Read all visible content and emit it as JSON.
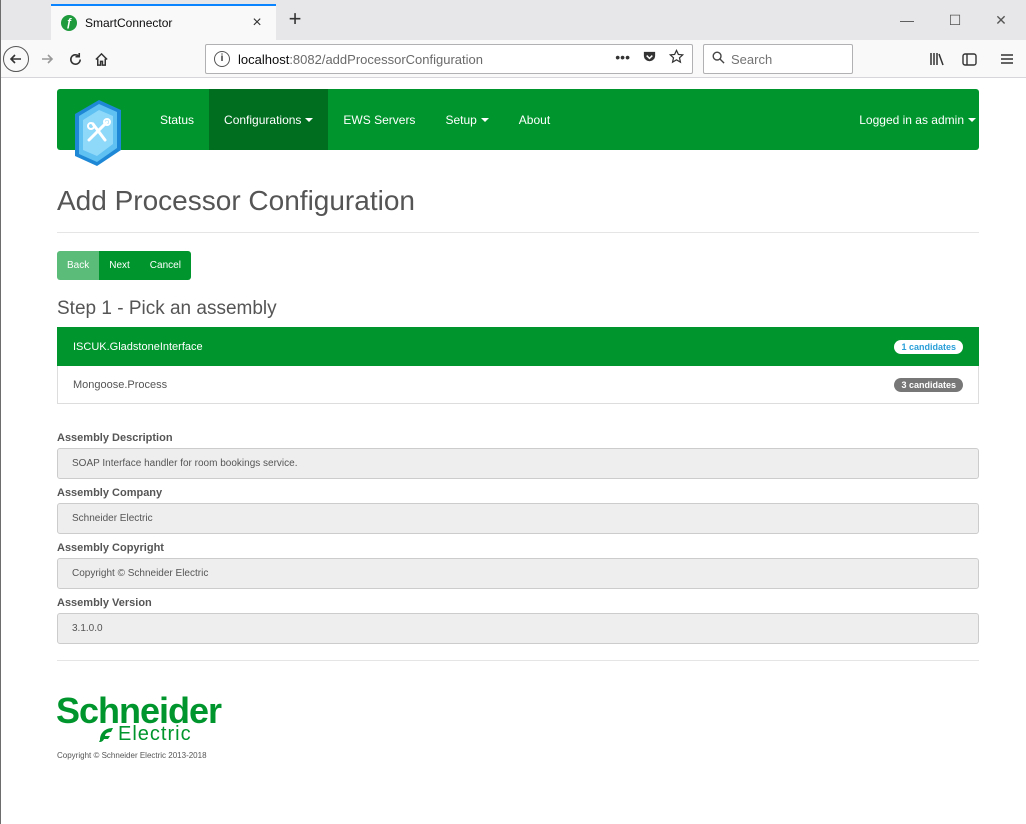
{
  "browser": {
    "tab_title": "SmartConnector",
    "tab_close": "×",
    "new_tab": "+",
    "url_host": "localhost",
    "url_path": ":8082/addProcessorConfiguration",
    "search_placeholder": "Search",
    "page_actions": "•••",
    "window_minimize": "—",
    "window_maximize": "☐",
    "window_close": "✕"
  },
  "app_nav": {
    "items": [
      {
        "label": "Status"
      },
      {
        "label": "Configurations"
      },
      {
        "label": "EWS Servers"
      },
      {
        "label": "Setup"
      },
      {
        "label": "About"
      }
    ],
    "user_label": "Logged in as admin"
  },
  "page": {
    "title": "Add Processor Configuration",
    "buttons": {
      "back": "Back",
      "next": "Next",
      "cancel": "Cancel"
    },
    "step_title": "Step 1 - Pick an assembly",
    "assemblies": [
      {
        "name": "ISCUK.GladstoneInterface",
        "badge": "1 candidates"
      },
      {
        "name": "Mongoose.Process",
        "badge": "3 candidates"
      }
    ],
    "fields": [
      {
        "label": "Assembly Description",
        "value": "SOAP Interface handler for room bookings service."
      },
      {
        "label": "Assembly Company",
        "value": "Schneider Electric"
      },
      {
        "label": "Assembly Copyright",
        "value": "Copyright © Schneider Electric"
      },
      {
        "label": "Assembly Version",
        "value": "3.1.0.0"
      }
    ]
  },
  "footer": {
    "brand": "Schneider",
    "brand_sub": "Electric",
    "copyright": "Copyright © Schneider Electric 2013-2018"
  },
  "colors": {
    "primary_green": "#00962d",
    "active_nav_green": "#006e1f",
    "back_button_green": "#5bbb78",
    "badge_blue": "#2a9fd8",
    "badge_gray": "#777777"
  }
}
